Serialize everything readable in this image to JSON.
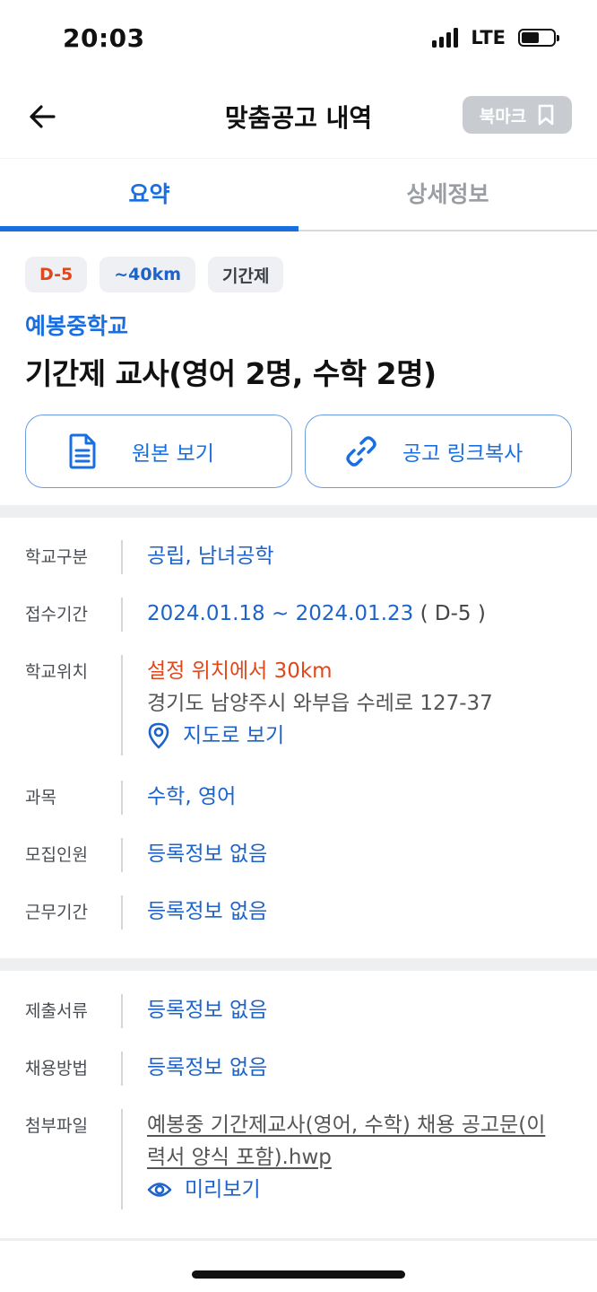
{
  "status_bar": {
    "time": "20:03",
    "network": "LTE",
    "battery_level": 0.55
  },
  "header": {
    "title": "맞춤공고 내역",
    "bookmark_label": "북마크"
  },
  "tabs": [
    {
      "label": "요약",
      "active": true
    },
    {
      "label": "상세정보",
      "active": false
    }
  ],
  "summary": {
    "chips": [
      "D-5",
      "~40km",
      "기간제"
    ],
    "school_name": "예봉중학교",
    "job_title": "기간제 교사(영어 2명, 수학 2명)",
    "buttons": {
      "original": "원본 보기",
      "copy_link": "공고 링크복사"
    }
  },
  "info1": {
    "school_type": {
      "label": "학교구분",
      "value": "공립, 남녀공학"
    },
    "period": {
      "label": "접수기간",
      "value": "2024.01.18 ~ 2024.01.23",
      "dday": " ( D-5 )"
    },
    "location": {
      "label": "학교위치",
      "distance": "설정 위치에서 30km",
      "address": "경기도 남양주시 와부읍 수레로 127-37",
      "map_link": "지도로 보기"
    },
    "subject": {
      "label": "과목",
      "value": "수학, 영어"
    },
    "recruit": {
      "label": "모집인원",
      "value": "등록정보 없음"
    },
    "work_period": {
      "label": "근무기간",
      "value": "등록정보 없음"
    }
  },
  "info2": {
    "documents": {
      "label": "제출서류",
      "value": "등록정보 없음"
    },
    "method": {
      "label": "채용방법",
      "value": "등록정보 없음"
    },
    "attachment": {
      "label": "첨부파일",
      "file_line1": "예봉중 기간제교사(영어,    수학) 채용 공고문(이",
      "file_line2": "력서 양식 포함).hwp",
      "preview": "미리보기"
    }
  },
  "colors": {
    "accent": "#1a6fe0",
    "warning": "#e2471b",
    "chip_bg": "#eef0f3",
    "bookmark_bg": "#c8cbd0"
  }
}
